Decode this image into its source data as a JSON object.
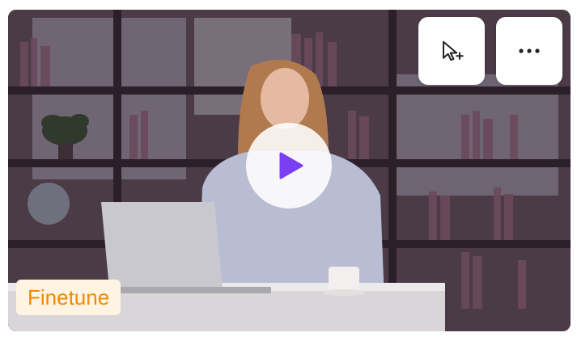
{
  "video_card": {
    "badge_label": "Finetune",
    "icons": {
      "add_to_selection": "cursor-add-icon",
      "more_options": "more-horizontal-icon",
      "play": "play-icon"
    },
    "colors": {
      "badge_text": "#f08a00",
      "badge_background": "#fff3e3",
      "play_accent": "#7b3ff2"
    }
  }
}
